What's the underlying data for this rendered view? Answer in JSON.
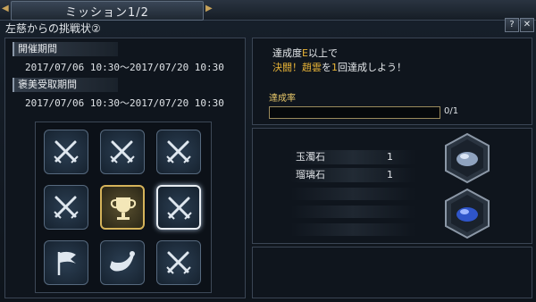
{
  "window": {
    "title": "ミッション1/2",
    "subtitle": "左慈からの挑戦状②",
    "help_label": "?",
    "close_label": "✕",
    "nav_prev": "◀",
    "nav_next": "▶"
  },
  "periods": {
    "event_label": "開催期間",
    "event_dates": "2017/07/06 10:30～2017/07/20 10:30",
    "reward_label": "褒美受取期間",
    "reward_dates": "2017/07/06 10:30～2017/07/20 10:30"
  },
  "mission_grid": [
    {
      "icon": "crossed-swords-icon"
    },
    {
      "icon": "crossed-swords-icon"
    },
    {
      "icon": "crossed-swords-icon"
    },
    {
      "icon": "crossed-swords-icon"
    },
    {
      "icon": "trophy-icon",
      "state": "gold"
    },
    {
      "icon": "crossed-swords-icon",
      "state": "selected"
    },
    {
      "icon": "flag-icon"
    },
    {
      "icon": "horn-icon"
    },
    {
      "icon": "crossed-swords-icon"
    }
  ],
  "mission": {
    "line1_a": "達成度",
    "line1_hl": "E",
    "line1_b": "以上で",
    "line2_hl1": "決闘！趙雲",
    "line2_a": "を",
    "line2_hl2": "1",
    "line2_b": "回達成しよう！",
    "rate_label": "達成率",
    "progress_text": "0/1",
    "progress_fraction": 0
  },
  "rewards": [
    {
      "name": "玉濁石",
      "qty": "1",
      "icon": "orb-gray-blue-icon"
    },
    {
      "name": "瑠璃石",
      "qty": "1",
      "icon": "orb-blue-icon"
    }
  ],
  "colors": {
    "highlight": "#e9b437",
    "gold_frame": "#d5b35a"
  }
}
